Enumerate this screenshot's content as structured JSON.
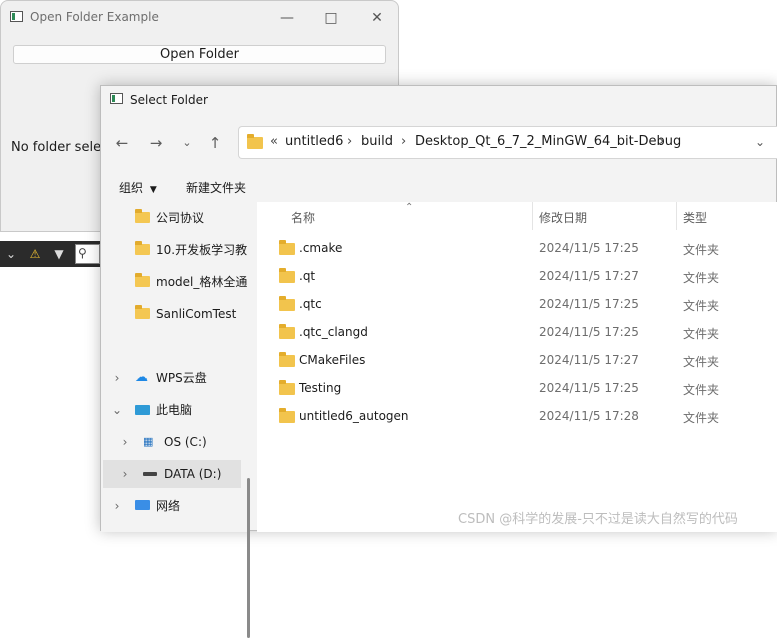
{
  "qt_window": {
    "title": "Open Folder Example",
    "open_button_label": "Open Folder",
    "status_text": "No folder selec"
  },
  "dialog": {
    "title": "Select Folder",
    "breadcrumb": [
      "untitled6",
      "build",
      "Desktop_Qt_6_7_2_MinGW_64_bit-Debug"
    ],
    "overflow_marker": "«",
    "commands": {
      "organize": "组织",
      "new_folder": "新建文件夹"
    },
    "nav": {
      "quick_access": [
        "公司协议",
        "10.开发板学习教",
        "model_格林全通",
        "SanliComTest"
      ],
      "wps": "WPS云盘",
      "this_pc": "此电脑",
      "drives": [
        "OS (C:)",
        "DATA (D:)"
      ],
      "network": "网络"
    },
    "columns": {
      "name": "名称",
      "date": "修改日期",
      "type": "类型"
    },
    "files": [
      {
        "name": ".cmake",
        "date": "2024/11/5 17:25",
        "type": "文件夹"
      },
      {
        "name": ".qt",
        "date": "2024/11/5 17:27",
        "type": "文件夹"
      },
      {
        "name": ".qtc",
        "date": "2024/11/5 17:25",
        "type": "文件夹"
      },
      {
        "name": ".qtc_clangd",
        "date": "2024/11/5 17:25",
        "type": "文件夹"
      },
      {
        "name": "CMakeFiles",
        "date": "2024/11/5 17:27",
        "type": "文件夹"
      },
      {
        "name": "Testing",
        "date": "2024/11/5 17:25",
        "type": "文件夹"
      },
      {
        "name": "untitled6_autogen",
        "date": "2024/11/5 17:28",
        "type": "文件夹"
      }
    ]
  },
  "watermark": "CSDN @科学的发展-只不过是读大自然写的代码"
}
